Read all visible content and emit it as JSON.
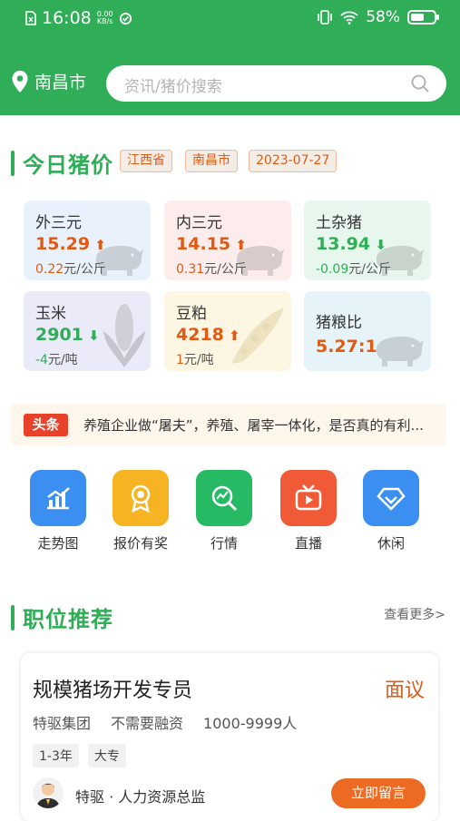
{
  "status_bar": {
    "time": "16:08",
    "speed_value": "0.00",
    "speed_unit": "KB/s",
    "battery": "58%",
    "battery_level": 0.58
  },
  "header": {
    "city": "南昌市",
    "search_placeholder": "资讯/猪价搜索"
  },
  "today_price": {
    "title": "今日猪价",
    "tags": [
      "江西省",
      "南昌市",
      "2023-07-27"
    ],
    "cards": [
      {
        "name": "外三元",
        "value": "15.29",
        "trend": "up",
        "change": "0.22",
        "unit": "元/公斤",
        "bg": "#e9f2fc",
        "image": "pig-icon"
      },
      {
        "name": "内三元",
        "value": "14.15",
        "trend": "up",
        "change": "0.31",
        "unit": "元/公斤",
        "bg": "#fcecec",
        "image": "pig-icon"
      },
      {
        "name": "土杂猪",
        "value": "13.94",
        "trend": "down",
        "change": "-0.09",
        "unit": "元/公斤",
        "bg": "#e8f7ee",
        "image": "pig-icon"
      },
      {
        "name": "玉米",
        "value": "2901",
        "trend": "down",
        "change": "-4",
        "unit": "元/吨",
        "bg": "#eaeaf8",
        "image": "corn-icon"
      },
      {
        "name": "豆粕",
        "value": "4218",
        "trend": "up",
        "change": "1",
        "unit": "元/吨",
        "bg": "#fcf6e2",
        "image": "bean-icon"
      },
      {
        "name": "猪粮比",
        "value": "5.27:1",
        "trend": "",
        "change": "",
        "unit": "",
        "bg": "#e6f3f9",
        "image": "pig-icon"
      }
    ]
  },
  "news": {
    "badge": "头条",
    "text": "养殖企业做“屠夫”，养殖、屠宰一体化，是否真的有利..."
  },
  "menu": [
    {
      "label": "走势图",
      "icon": "trend-chart-icon",
      "color": "#3b8ff0"
    },
    {
      "label": "报价有奖",
      "icon": "award-medal-icon",
      "color": "#f6b322"
    },
    {
      "label": "行情",
      "icon": "market-search-icon",
      "color": "#25ba63"
    },
    {
      "label": "直播",
      "icon": "live-tv-icon",
      "color": "#f05a36"
    },
    {
      "label": "休闲",
      "icon": "diamond-icon",
      "color": "#3b8ff0"
    }
  ],
  "jobs_section": {
    "title": "职位推荐",
    "more": "查看更多>"
  },
  "job": {
    "title": "规模猪场开发专员",
    "salary": "面议",
    "meta": [
      "特驱集团",
      "不需要融资",
      "1000-9999人"
    ],
    "tags": [
      "1-3年",
      "大专"
    ],
    "contact": "特驱 · 人力资源总监",
    "apply": "立即留言"
  },
  "colors": {
    "brand": "#2fae57",
    "accent": "#e05a12",
    "badge": "#e8422a"
  }
}
